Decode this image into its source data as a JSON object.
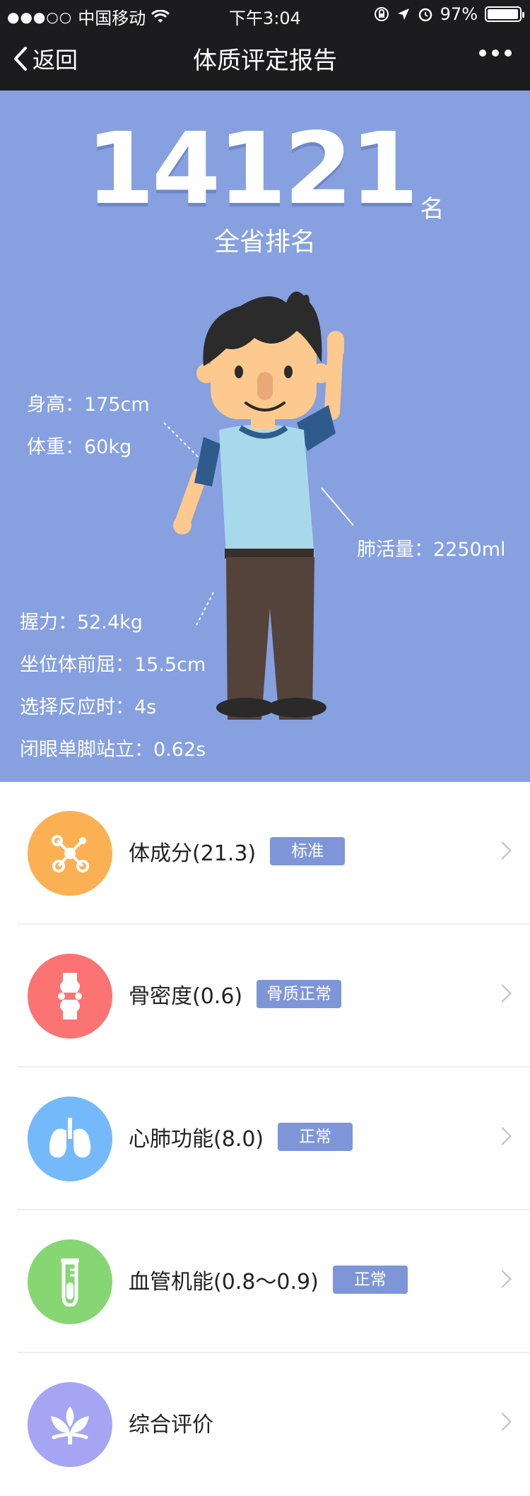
{
  "status_bar": {
    "signal": "●●●○○",
    "carrier": "中国移动",
    "time": "下午3:04",
    "battery": "97%",
    "battery_level": 0.97
  },
  "nav": {
    "back_label": "返回",
    "title": "体质评定报告"
  },
  "hero": {
    "rank_value": "14121",
    "rank_unit": "名",
    "rank_label": "全省排名",
    "metrics": {
      "height": "身高：175cm",
      "weight": "体重：60kg",
      "lung": "肺活量：2250ml",
      "grip": "握力：52.4kg",
      "flex": "坐位体前屈：15.5cm",
      "reaction": "选择反应时：4s",
      "balance": "闭眼单脚站立：0.62s"
    }
  },
  "items": [
    {
      "label": "体成分(21.3)",
      "badge": "标准",
      "icon": "molecule-icon",
      "color": "#fbb153"
    },
    {
      "label": "骨密度(0.6)",
      "badge": "骨质正常",
      "icon": "bone-joint-icon",
      "color": "#fb7373"
    },
    {
      "label": "心肺功能(8.0)",
      "badge": "正常",
      "icon": "lungs-icon",
      "color": "#74b9f9"
    },
    {
      "label": "血管机能(0.8～0.9)",
      "badge": "正常",
      "icon": "test-tube-icon",
      "color": "#86d673"
    },
    {
      "label": "综合评价",
      "badge": "",
      "icon": "lotus-icon",
      "color": "#a5a5f3"
    }
  ],
  "colors": {
    "hero_bg": "#86a0e0",
    "badge_bg": "#7e96d7",
    "topbar": "#1c1c1e"
  }
}
